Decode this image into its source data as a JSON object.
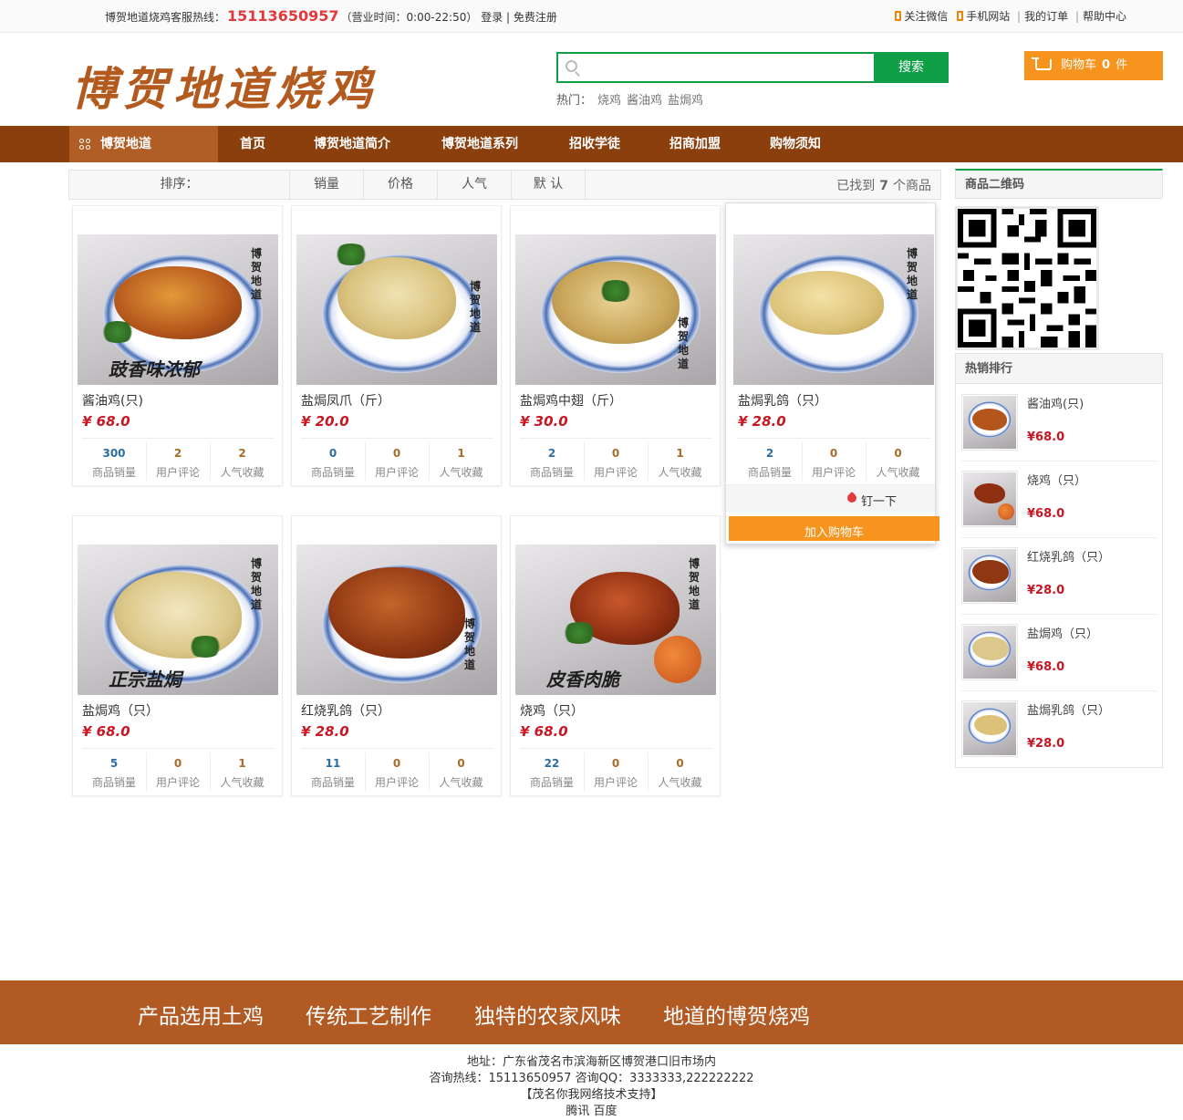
{
  "topbar": {
    "hotline_label": "博贺地道烧鸡客服热线：",
    "hotline": "15113650957",
    "hours": "（营业时间：0:00-22:50）",
    "login": "登录",
    "register": "| 免费注册",
    "wechat": "关注微信",
    "mobile": "手机网站",
    "orders": "我的订单",
    "help": "帮助中心"
  },
  "header": {
    "logo_text": "博贺地道烧鸡",
    "search_placeholder": "",
    "search_button": "搜索",
    "hot_label": "热门：",
    "hot_keywords": [
      "烧鸡",
      "酱油鸡",
      "盐焗鸡"
    ],
    "cart_label": "购物车",
    "cart_count": "0",
    "cart_unit": "件"
  },
  "nav": {
    "category": "博贺地道",
    "items": [
      "首页",
      "博贺地道简介",
      "博贺地道系列",
      "招收学徒",
      "招商加盟",
      "购物须知"
    ]
  },
  "sortbar": {
    "label": "排序：",
    "options": [
      "销量",
      "价格",
      "人气",
      "默 认"
    ],
    "found_prefix": "已找到",
    "found_count": "7",
    "found_suffix": "个商品"
  },
  "stat_labels": [
    "商品销量",
    "用户评论",
    "人气收藏"
  ],
  "products": [
    {
      "name": "酱油鸡(只)",
      "price": "¥ 68.0",
      "sales": "300",
      "comments": "2",
      "favs": "2",
      "slogan": "豉香味浓郁"
    },
    {
      "name": "盐焗凤爪（斤）",
      "price": "¥ 20.0",
      "sales": "0",
      "comments": "0",
      "favs": "1",
      "slogan": ""
    },
    {
      "name": "盐焗鸡中翅（斤）",
      "price": "¥ 30.0",
      "sales": "2",
      "comments": "0",
      "favs": "1",
      "slogan": ""
    },
    {
      "name": "盐焗乳鸽（只）",
      "price": "¥ 28.0",
      "sales": "2",
      "comments": "0",
      "favs": "0",
      "slogan": ""
    },
    {
      "name": "盐焗鸡（只）",
      "price": "¥ 68.0",
      "sales": "5",
      "comments": "0",
      "favs": "1",
      "slogan": "正宗盐焗"
    },
    {
      "name": "红烧乳鸽（只）",
      "price": "¥ 28.0",
      "sales": "11",
      "comments": "0",
      "favs": "0",
      "slogan": ""
    },
    {
      "name": "烧鸡（只）",
      "price": "¥ 68.0",
      "sales": "22",
      "comments": "0",
      "favs": "0",
      "slogan": "皮香肉脆"
    }
  ],
  "photo_brand": "博贺地道",
  "pin_label": "钉一下",
  "addcart_label": "加入购物车",
  "sidebar": {
    "qr_title": "商品二维码",
    "hot_title": "热销排行",
    "hot_items": [
      {
        "name": "酱油鸡(只)",
        "price": "¥68.0"
      },
      {
        "name": "烧鸡（只）",
        "price": "¥68.0"
      },
      {
        "name": "红烧乳鸽（只）",
        "price": "¥28.0"
      },
      {
        "name": "盐焗鸡（只）",
        "price": "¥68.0"
      },
      {
        "name": "盐焗乳鸽（只）",
        "price": "¥28.0"
      }
    ]
  },
  "slogans": [
    "产品选用土鸡",
    "传统工艺制作",
    "独特的农家风味",
    "地道的博贺烧鸡"
  ],
  "footer": {
    "address": "地址：广东省茂名市滨海新区博贺港口旧市场内",
    "contact": "咨询热线：15113650957    咨询QQ：3333333,222222222",
    "support": "【茂名你我网络技术支持】",
    "links": "腾讯 百度"
  },
  "colors": {
    "nav_bg": "#8a3f0c",
    "accent_green": "#109f47",
    "cart_orange": "#f7941d",
    "price_red": "#c81623",
    "footer_band": "#b15a24"
  }
}
